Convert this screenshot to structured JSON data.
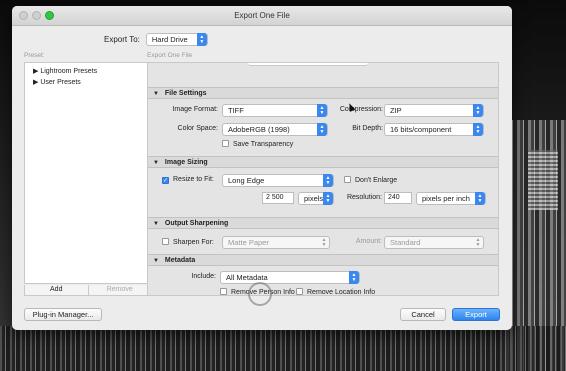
{
  "window": {
    "title": "Export One File"
  },
  "export_to": {
    "label": "Export To:",
    "value": "Hard Drive"
  },
  "preset": {
    "label": "Preset:",
    "items": [
      "Lightroom Presets",
      "User Presets"
    ],
    "add_label": "Add",
    "remove_label": "Remove"
  },
  "panel_label": "Export One File",
  "file_settings": {
    "title": "File Settings",
    "image_format_label": "Image Format:",
    "image_format": "TIFF",
    "compression_label": "Compression:",
    "compression": "ZIP",
    "color_space_label": "Color Space:",
    "color_space": "AdobeRGB (1998)",
    "bit_depth_label": "Bit Depth:",
    "bit_depth": "16 bits/component",
    "save_transparency": "Save Transparency"
  },
  "image_sizing": {
    "title": "Image Sizing",
    "resize_label": "Resize to Fit:",
    "resize_mode": "Long Edge",
    "dont_enlarge": "Don't Enlarge",
    "size_value": "2 500",
    "size_unit": "pixels",
    "resolution_label": "Resolution:",
    "resolution_value": "240",
    "resolution_unit": "pixels per inch"
  },
  "output_sharpening": {
    "title": "Output Sharpening",
    "sharpen_label": "Sharpen For:",
    "sharpen_value": "Matte Paper",
    "amount_label": "Amount:",
    "amount_value": "Standard"
  },
  "metadata": {
    "title": "Metadata",
    "include_label": "Include:",
    "include_value": "All Metadata",
    "remove_person": "Remove Person Info",
    "remove_location": "Remove Location Info"
  },
  "buttons": {
    "plugin_manager": "Plug-in Manager...",
    "cancel": "Cancel",
    "export": "Export"
  },
  "colors": {
    "accent": "#3b87f0",
    "close_green": "#2fc840"
  }
}
